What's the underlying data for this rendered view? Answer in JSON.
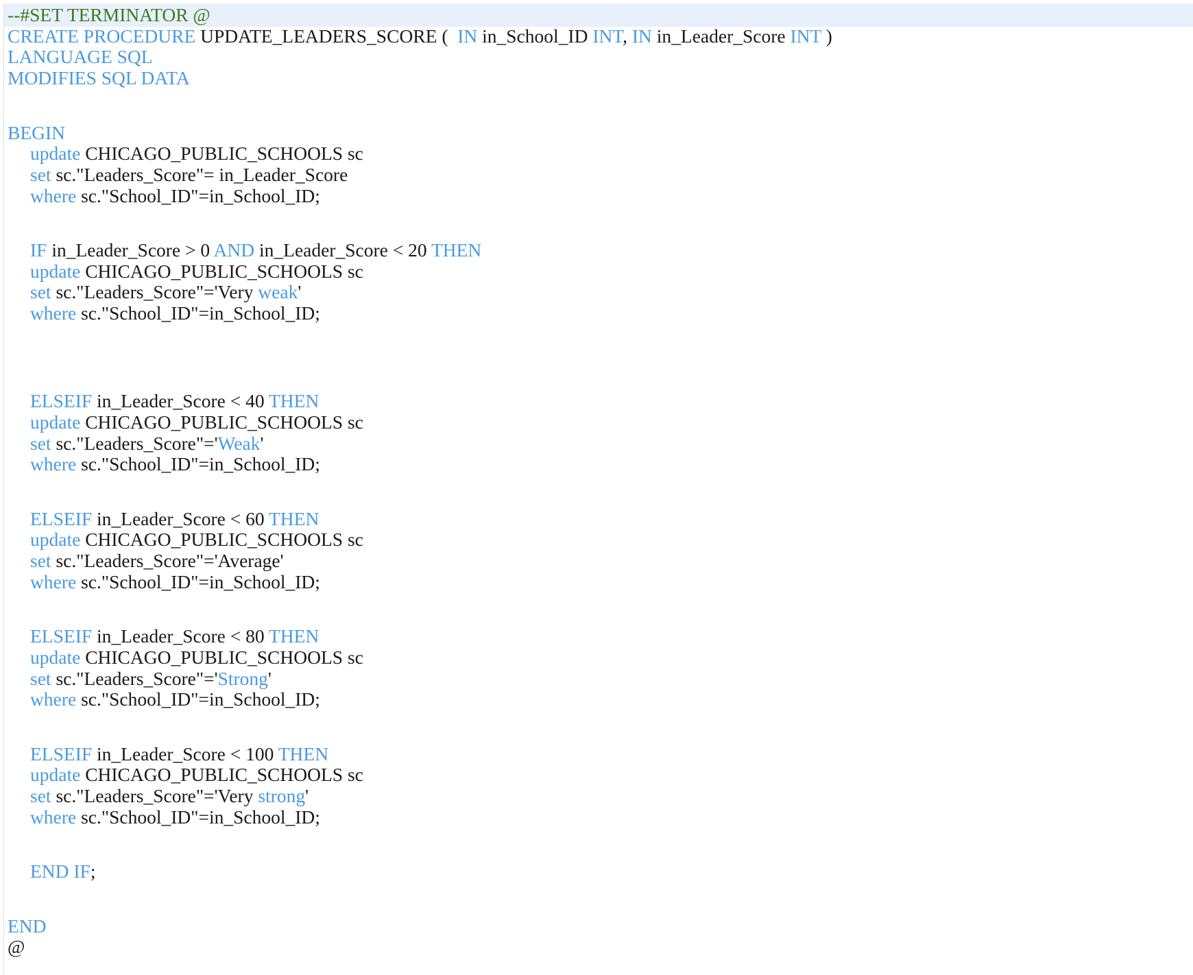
{
  "colors": {
    "keyword": "#4a9ae0",
    "comment": "#3e7a1f",
    "text": "#1a1a1a",
    "active_line": "#e8f0fb"
  },
  "editor": {
    "active_line": 0,
    "lines": [
      {
        "indent": 0,
        "tokens": [
          {
            "t": "cm",
            "s": "--#SET TERMINATOR @"
          }
        ]
      },
      {
        "indent": 0,
        "tokens": [
          {
            "t": "kw",
            "s": "CREATE PROCEDURE"
          },
          {
            "t": "tx",
            "s": " UPDATE_LEADERS_SCORE (  "
          },
          {
            "t": "kw",
            "s": "IN"
          },
          {
            "t": "tx",
            "s": " in_School_ID "
          },
          {
            "t": "kw",
            "s": "INT"
          },
          {
            "t": "tx",
            "s": ", "
          },
          {
            "t": "kw",
            "s": "IN"
          },
          {
            "t": "tx",
            "s": " in_Leader_Score "
          },
          {
            "t": "kw",
            "s": "INT"
          },
          {
            "t": "tx",
            "s": " )"
          }
        ]
      },
      {
        "indent": 0,
        "tokens": [
          {
            "t": "kw",
            "s": "LANGUAGE SQL"
          }
        ]
      },
      {
        "indent": 0,
        "tokens": [
          {
            "t": "kw",
            "s": "MODIFIES SQL DATA"
          }
        ]
      },
      {
        "indent": 0,
        "tokens": []
      },
      {
        "indent": 0,
        "tokens": [
          {
            "t": "kw",
            "s": "BEGIN"
          }
        ]
      },
      {
        "indent": 1,
        "tokens": [
          {
            "t": "kw",
            "s": "update"
          },
          {
            "t": "tx",
            "s": " CHICAGO_PUBLIC_SCHOOLS sc"
          }
        ]
      },
      {
        "indent": 1,
        "tokens": [
          {
            "t": "kw",
            "s": "set"
          },
          {
            "t": "tx",
            "s": " sc.\"Leaders_Score\"= in_Leader_Score"
          }
        ]
      },
      {
        "indent": 1,
        "tokens": [
          {
            "t": "kw",
            "s": "where"
          },
          {
            "t": "tx",
            "s": " sc.\"School_ID\"=in_School_ID;"
          }
        ]
      },
      {
        "indent": 0,
        "tokens": []
      },
      {
        "indent": 1,
        "tokens": [
          {
            "t": "kw",
            "s": "IF"
          },
          {
            "t": "tx",
            "s": " in_Leader_Score > 0 "
          },
          {
            "t": "kw",
            "s": "AND"
          },
          {
            "t": "tx",
            "s": " in_Leader_Score < 20 "
          },
          {
            "t": "kw",
            "s": "THEN"
          }
        ]
      },
      {
        "indent": 1,
        "tokens": [
          {
            "t": "kw",
            "s": "update"
          },
          {
            "t": "tx",
            "s": " CHICAGO_PUBLIC_SCHOOLS sc"
          }
        ]
      },
      {
        "indent": 1,
        "tokens": [
          {
            "t": "kw",
            "s": "set"
          },
          {
            "t": "tx",
            "s": " sc.\"Leaders_Score\"='Very "
          },
          {
            "t": "kw",
            "s": "weak"
          },
          {
            "t": "tx",
            "s": "'"
          }
        ]
      },
      {
        "indent": 1,
        "tokens": [
          {
            "t": "kw",
            "s": "where"
          },
          {
            "t": "tx",
            "s": " sc.\"School_ID\"=in_School_ID;"
          }
        ]
      },
      {
        "indent": 0,
        "tokens": []
      },
      {
        "indent": 0,
        "tokens": []
      },
      {
        "indent": 1,
        "tokens": [
          {
            "t": "kw",
            "s": "ELSEIF"
          },
          {
            "t": "tx",
            "s": " in_Leader_Score < 40 "
          },
          {
            "t": "kw",
            "s": "THEN"
          }
        ]
      },
      {
        "indent": 1,
        "tokens": [
          {
            "t": "kw",
            "s": "update"
          },
          {
            "t": "tx",
            "s": " CHICAGO_PUBLIC_SCHOOLS sc"
          }
        ]
      },
      {
        "indent": 1,
        "tokens": [
          {
            "t": "kw",
            "s": "set"
          },
          {
            "t": "tx",
            "s": " sc.\"Leaders_Score\"='"
          },
          {
            "t": "kw",
            "s": "Weak"
          },
          {
            "t": "tx",
            "s": "'"
          }
        ]
      },
      {
        "indent": 1,
        "tokens": [
          {
            "t": "kw",
            "s": "where"
          },
          {
            "t": "tx",
            "s": " sc.\"School_ID\"=in_School_ID;"
          }
        ]
      },
      {
        "indent": 0,
        "tokens": []
      },
      {
        "indent": 1,
        "tokens": [
          {
            "t": "kw",
            "s": "ELSEIF"
          },
          {
            "t": "tx",
            "s": " in_Leader_Score < 60 "
          },
          {
            "t": "kw",
            "s": "THEN"
          }
        ]
      },
      {
        "indent": 1,
        "tokens": [
          {
            "t": "kw",
            "s": "update"
          },
          {
            "t": "tx",
            "s": " CHICAGO_PUBLIC_SCHOOLS sc"
          }
        ]
      },
      {
        "indent": 1,
        "tokens": [
          {
            "t": "kw",
            "s": "set"
          },
          {
            "t": "tx",
            "s": " sc.\"Leaders_Score\"='Average'"
          }
        ]
      },
      {
        "indent": 1,
        "tokens": [
          {
            "t": "kw",
            "s": "where"
          },
          {
            "t": "tx",
            "s": " sc.\"School_ID\"=in_School_ID;"
          }
        ]
      },
      {
        "indent": 0,
        "tokens": []
      },
      {
        "indent": 1,
        "tokens": [
          {
            "t": "kw",
            "s": "ELSEIF"
          },
          {
            "t": "tx",
            "s": " in_Leader_Score < 80 "
          },
          {
            "t": "kw",
            "s": "THEN"
          }
        ]
      },
      {
        "indent": 1,
        "tokens": [
          {
            "t": "kw",
            "s": "update"
          },
          {
            "t": "tx",
            "s": " CHICAGO_PUBLIC_SCHOOLS sc"
          }
        ]
      },
      {
        "indent": 1,
        "tokens": [
          {
            "t": "kw",
            "s": "set"
          },
          {
            "t": "tx",
            "s": " sc.\"Leaders_Score\"='"
          },
          {
            "t": "kw",
            "s": "Strong"
          },
          {
            "t": "tx",
            "s": "'"
          }
        ]
      },
      {
        "indent": 1,
        "tokens": [
          {
            "t": "kw",
            "s": "where"
          },
          {
            "t": "tx",
            "s": " sc.\"School_ID\"=in_School_ID;"
          }
        ]
      },
      {
        "indent": 0,
        "tokens": []
      },
      {
        "indent": 1,
        "tokens": [
          {
            "t": "kw",
            "s": "ELSEIF"
          },
          {
            "t": "tx",
            "s": " in_Leader_Score < 100 "
          },
          {
            "t": "kw",
            "s": "THEN"
          }
        ]
      },
      {
        "indent": 1,
        "tokens": [
          {
            "t": "kw",
            "s": "update"
          },
          {
            "t": "tx",
            "s": " CHICAGO_PUBLIC_SCHOOLS sc"
          }
        ]
      },
      {
        "indent": 1,
        "tokens": [
          {
            "t": "kw",
            "s": "set"
          },
          {
            "t": "tx",
            "s": " sc.\"Leaders_Score\"='Very "
          },
          {
            "t": "kw",
            "s": "strong"
          },
          {
            "t": "tx",
            "s": "'"
          }
        ]
      },
      {
        "indent": 1,
        "tokens": [
          {
            "t": "kw",
            "s": "where"
          },
          {
            "t": "tx",
            "s": " sc.\"School_ID\"=in_School_ID;"
          }
        ]
      },
      {
        "indent": 0,
        "tokens": []
      },
      {
        "indent": 1,
        "tokens": [
          {
            "t": "kw",
            "s": "END IF"
          },
          {
            "t": "tx",
            "s": ";"
          }
        ]
      },
      {
        "indent": 0,
        "tokens": []
      },
      {
        "indent": 0,
        "tokens": [
          {
            "t": "kw",
            "s": "END"
          }
        ]
      },
      {
        "indent": 0,
        "tokens": [
          {
            "t": "tx",
            "s": "@"
          }
        ]
      }
    ]
  }
}
